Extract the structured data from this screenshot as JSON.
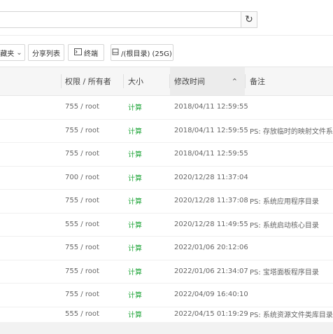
{
  "toolbar": {
    "favorites_partial": "藏夹",
    "share_list": "分享列表",
    "terminal": "终端",
    "disk": "/(根目录) (25G)"
  },
  "table": {
    "headers": {
      "permission_owner": "权限 / 所有者",
      "size": "大小",
      "modified": "修改时间",
      "remark": "备注"
    },
    "rows": [
      {
        "perm": "755 / root",
        "size": "计算",
        "mtime": "2018/04/11 12:59:55",
        "remark": ""
      },
      {
        "perm": "755 / root",
        "size": "计算",
        "mtime": "2018/04/11 12:59:55",
        "remark": "PS: 存放临时的映射文件系统"
      },
      {
        "perm": "755 / root",
        "size": "计算",
        "mtime": "2018/04/11 12:59:55",
        "remark": ""
      },
      {
        "perm": "700 / root",
        "size": "计算",
        "mtime": "2020/12/28 11:37:04",
        "remark": ""
      },
      {
        "perm": "755 / root",
        "size": "计算",
        "mtime": "2020/12/28 11:37:08",
        "remark": "PS: 系统应用程序目录"
      },
      {
        "perm": "555 / root",
        "size": "计算",
        "mtime": "2020/12/28 11:49:55",
        "remark": "PS: 系统启动核心目录"
      },
      {
        "perm": "755 / root",
        "size": "计算",
        "mtime": "2022/01/06 20:12:06",
        "remark": ""
      },
      {
        "perm": "755 / root",
        "size": "计算",
        "mtime": "2022/01/06 21:34:07",
        "remark": "PS: 宝塔面板程序目录"
      },
      {
        "perm": "755 / root",
        "size": "计算",
        "mtime": "2022/04/09 16:40:10",
        "remark": ""
      },
      {
        "perm": "555 / root",
        "size": "计算",
        "mtime": "2022/04/15 01:19:29",
        "remark": "PS: 系统资源文件类库目录"
      }
    ]
  },
  "colors": {
    "size_link": "#20a53a",
    "header_bg": "#f6f6f6"
  },
  "icons": {
    "refresh": "refresh-icon",
    "chevron": "chevron-down-icon",
    "terminal": "terminal-icon",
    "disk": "disk-icon",
    "sort": "sort-up-icon"
  }
}
